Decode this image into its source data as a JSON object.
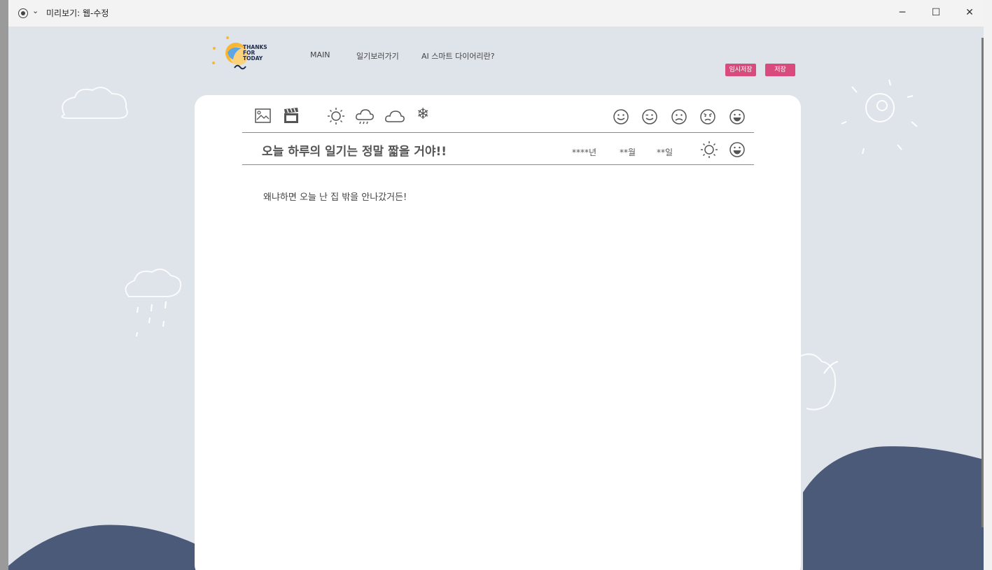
{
  "window": {
    "title": "미리보기: 웹-수정",
    "minimize_label": "─",
    "maximize_label": "☐",
    "close_label": "✕"
  },
  "logo": {
    "line1": "THANKS",
    "line2": "FOR",
    "line3": "TODAY"
  },
  "nav": {
    "items": [
      "MAIN",
      "일기보러가기",
      "AI 스마트 다이어리란?"
    ]
  },
  "buttons": {
    "temp_save": "임시저장",
    "save": "저장"
  },
  "colors": {
    "background": "#dfe3ea",
    "accent_pink": "#d94b7c",
    "wave_navy": "#4a5a78"
  },
  "toolbar": {
    "media_icons": [
      "image-icon",
      "video-clapper-icon"
    ],
    "weather_icons": [
      "sun-icon",
      "rain-cloud-icon",
      "cloud-icon",
      "snowflake-icon"
    ],
    "mood_icons": [
      "smile-icon",
      "wink-icon",
      "sad-icon",
      "angry-icon",
      "laugh-icon"
    ]
  },
  "diary": {
    "title": "오늘 하루의 일기는 정말 짧을 거야!!",
    "year": "****년",
    "month": "**월",
    "day": "**일",
    "selected_weather_icon": "sun-icon",
    "selected_mood_icon": "laugh-icon",
    "content": "왜냐하면 오늘 난 집 밖을 안나갔거든!"
  }
}
